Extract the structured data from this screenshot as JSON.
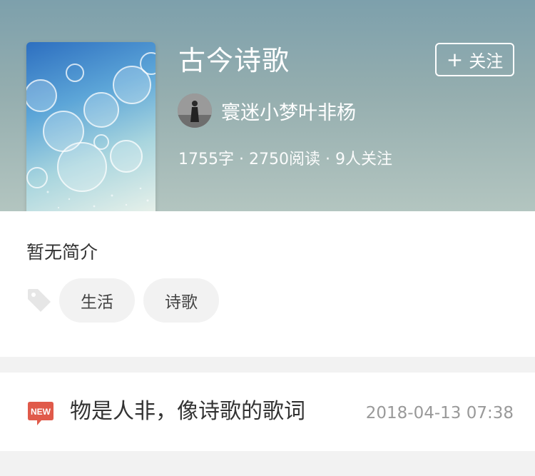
{
  "collection": {
    "title": "古今诗歌",
    "follow_label": "关注",
    "follow_plus": "+",
    "author": "寰迷小梦叶非杨",
    "stats": {
      "words": "1755字",
      "reads": "2750阅读",
      "followers": "9人关注",
      "separator": "·"
    },
    "intro": "暂无简介",
    "tags": [
      "生活",
      "诗歌"
    ]
  },
  "articles": [
    {
      "badge": "NEW",
      "title": "物是人非，像诗歌的歌词",
      "time": "2018-04-13 07:38"
    }
  ],
  "colors": {
    "header_top": "#7da0ac",
    "header_bottom": "#b3c5c0",
    "new_badge": "#e05a4a",
    "tag_bg": "#f2f2f2",
    "time_text": "#999999"
  },
  "icons": {
    "tag": "tag-icon",
    "new": "new-badge-icon",
    "plus": "plus-icon"
  }
}
